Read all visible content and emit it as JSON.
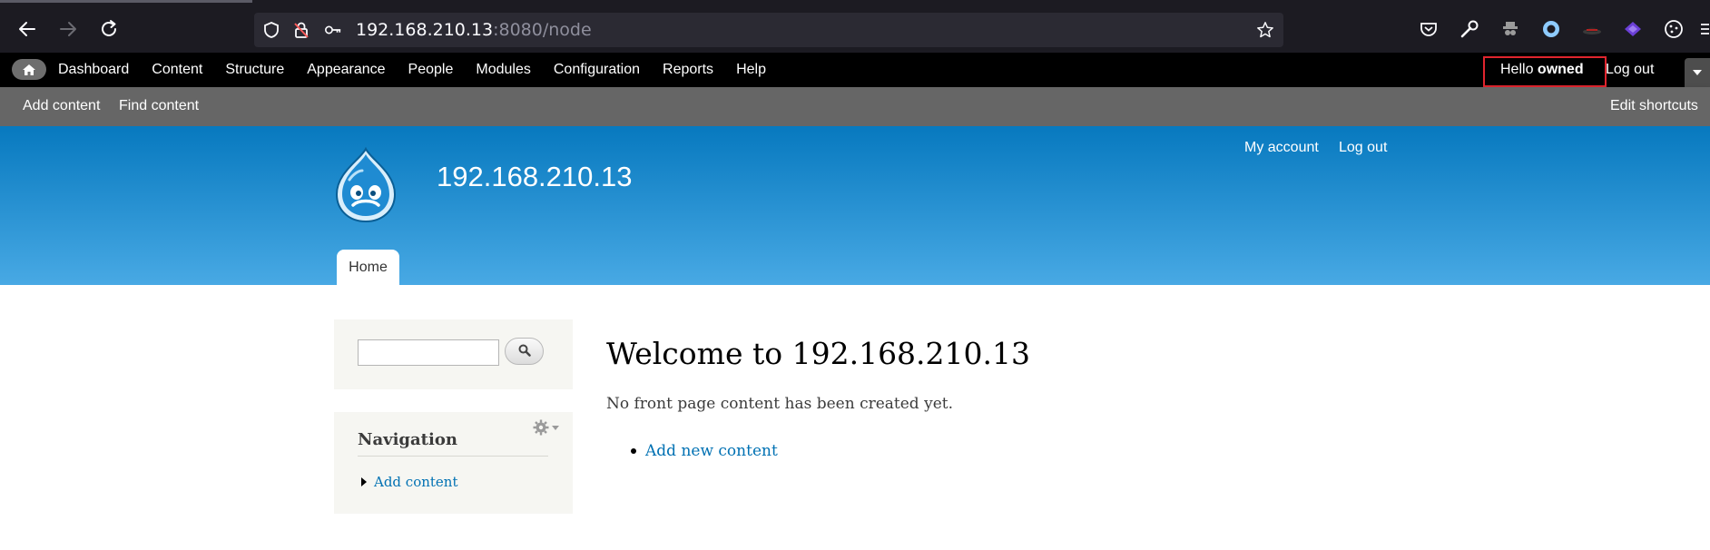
{
  "browser": {
    "url_host": "192.168.210.13",
    "url_path": ":8080/node"
  },
  "admin_toolbar": {
    "menu": [
      "Dashboard",
      "Content",
      "Structure",
      "Appearance",
      "People",
      "Modules",
      "Configuration",
      "Reports",
      "Help"
    ],
    "greeting": "Hello",
    "username": "owned",
    "logout": "Log out"
  },
  "shortcuts": {
    "add_content": "Add content",
    "find_content": "Find content",
    "edit_shortcuts": "Edit shortcuts"
  },
  "header": {
    "site_name": "192.168.210.13",
    "my_account": "My account",
    "logout": "Log out",
    "home_tab": "Home"
  },
  "sidebar": {
    "nav_title": "Navigation",
    "nav_link": "Add content"
  },
  "main": {
    "title": "Welcome to 192.168.210.13",
    "text": "No front page content has been created yet.",
    "link": "Add new content"
  },
  "colors": {
    "link": "#0071b3",
    "header_top": "#0779bf",
    "header_bottom": "#48a9e4",
    "highlight_border": "#e0252e"
  }
}
